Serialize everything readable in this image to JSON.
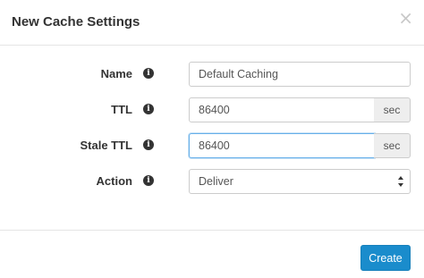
{
  "modal": {
    "title": "New Cache Settings",
    "close_glyph": "×"
  },
  "form": {
    "name": {
      "label": "Name",
      "value": "Default Caching",
      "info_icon": "info-icon"
    },
    "ttl": {
      "label": "TTL",
      "value": "86400",
      "unit": "sec",
      "info_icon": "info-icon"
    },
    "stale_ttl": {
      "label": "Stale TTL",
      "value": "86400",
      "unit": "sec",
      "info_icon": "info-icon"
    },
    "action": {
      "label": "Action",
      "selected": "Deliver",
      "info_icon": "info-icon"
    }
  },
  "footer": {
    "create_label": "Create"
  },
  "colors": {
    "primary": "#1a8ccc",
    "focus": "#66afe9",
    "addon_bg": "#eeeeee",
    "border": "#cccccc"
  }
}
